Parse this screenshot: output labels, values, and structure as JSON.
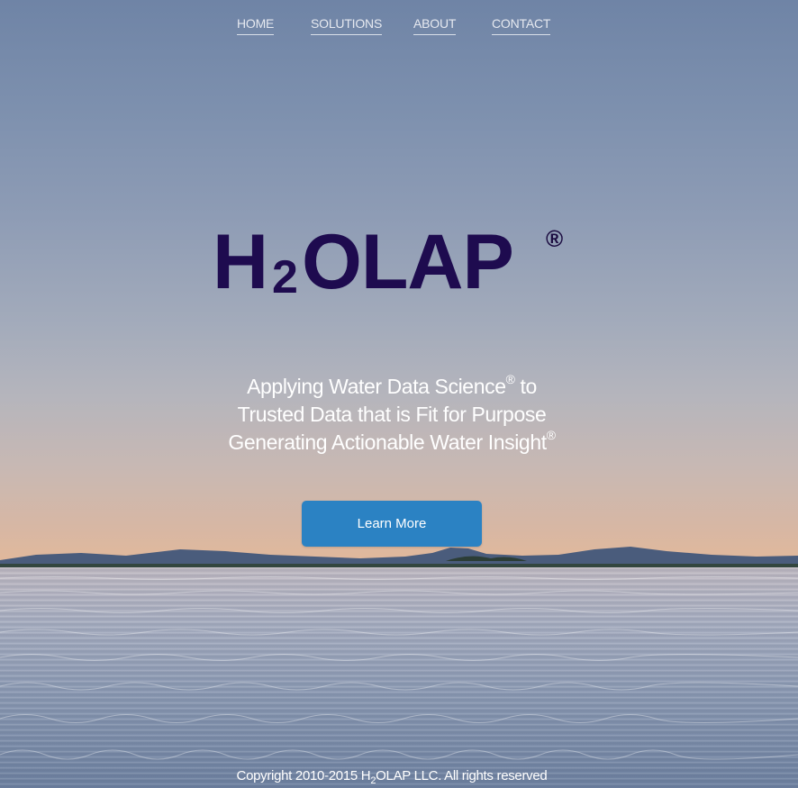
{
  "nav": {
    "items": [
      {
        "label": "HOME"
      },
      {
        "label": "SOLUTIONS"
      },
      {
        "label": "ABOUT"
      },
      {
        "label": "CONTACT"
      }
    ]
  },
  "logo": {
    "letter_h": "H",
    "subscript": "2",
    "rest": "OLAP",
    "registered": "®",
    "color": "#1e0b4f"
  },
  "tagline": {
    "line1_text": "Applying Water Data Science",
    "line1_mark": "®",
    "line1_tail": " to",
    "line2": "Trusted Data that is Fit for Purpose",
    "line3_text": "Generating Actionable Water Insight",
    "line3_mark": "®"
  },
  "cta": {
    "label": "Learn More",
    "color": "#2b82c3"
  },
  "footer": {
    "prefix": "Copyright 2010-2015 H",
    "subscript": "2",
    "suffix": "OLAP LLC. All rights reserved"
  },
  "colors": {
    "sky_top": "#6f84a6",
    "horizon": "#e0b89c",
    "water": "#8d9bb4"
  }
}
